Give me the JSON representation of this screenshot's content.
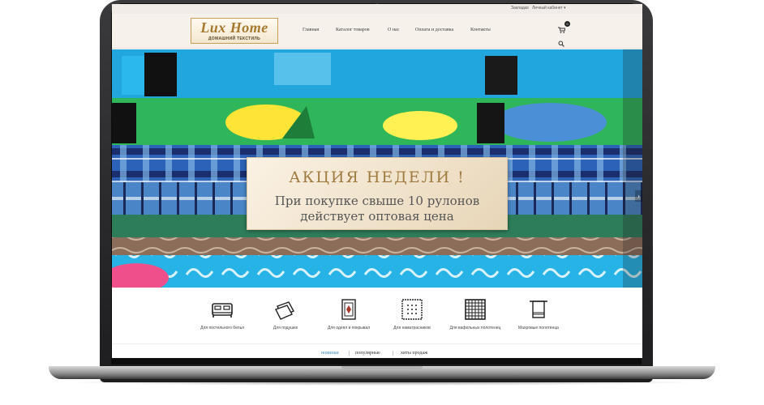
{
  "topbar": {
    "bookmarks": "Закладки",
    "account": "Личный кабинет ▾"
  },
  "logo": {
    "main": "Lux Home",
    "sub": "ДОМАШНИЙ ТЕКСТИЛЬ"
  },
  "nav": [
    {
      "label": "Главная"
    },
    {
      "label": "Каталог товаров"
    },
    {
      "label": "О нас"
    },
    {
      "label": "Оплата и доставка"
    },
    {
      "label": "Контакты"
    }
  ],
  "cart": {
    "count": "0"
  },
  "promo": {
    "title": "АКЦИЯ НЕДЕЛИ !",
    "line1": "При покупке свыше 10 рулонов",
    "line2": "действует оптовая цена"
  },
  "categories": [
    {
      "label": "Для постельного белья",
      "icon": "bed-icon"
    },
    {
      "label": "Для подушек",
      "icon": "pillow-icon"
    },
    {
      "label": "Для одеял и покрывал",
      "icon": "blanket-icon"
    },
    {
      "label": "Для наматрасников",
      "icon": "mattress-icon"
    },
    {
      "label": "Для вафельных полотенец",
      "icon": "waffle-towel-icon"
    },
    {
      "label": "Махровые полотенца",
      "icon": "terry-towel-icon"
    }
  ],
  "tabs": {
    "new": "новинки",
    "popular": "популярные",
    "hits": "хиты продаж"
  },
  "colors": {
    "accent_gold": "#a4792f",
    "tab_active": "#3a8ac0",
    "header_bg": "#f7f1ec"
  }
}
